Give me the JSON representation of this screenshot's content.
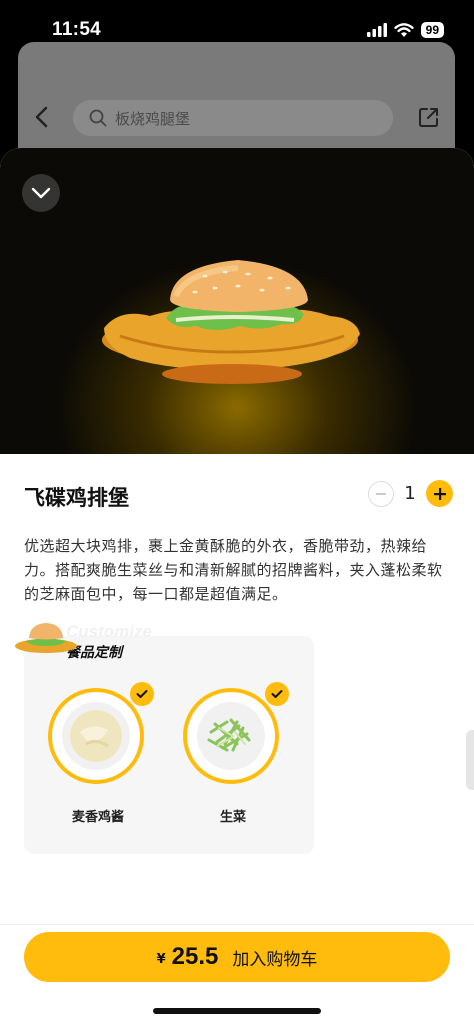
{
  "status_bar": {
    "time": "11:54",
    "battery": "99"
  },
  "background_page": {
    "search_placeholder": "板烧鸡腿堡"
  },
  "product": {
    "name": "飞碟鸡排堡",
    "quantity": "1",
    "description": "优选超大块鸡排，裹上金黄酥脆的外衣，香脆带劲，热辣给力。搭配爽脆生菜丝与和清新解腻的招牌酱料，夹入蓬松柔软的芝麻面包中，每一口都是超值满足。"
  },
  "customize": {
    "title_en": "Customize",
    "title": "餐品定制",
    "options": [
      {
        "label": "麦香鸡酱",
        "selected": true
      },
      {
        "label": "生菜",
        "selected": true
      }
    ]
  },
  "cart": {
    "currency": "¥",
    "price": "25.5",
    "label": "加入购物车"
  },
  "colors": {
    "accent": "#ffbc0d"
  }
}
